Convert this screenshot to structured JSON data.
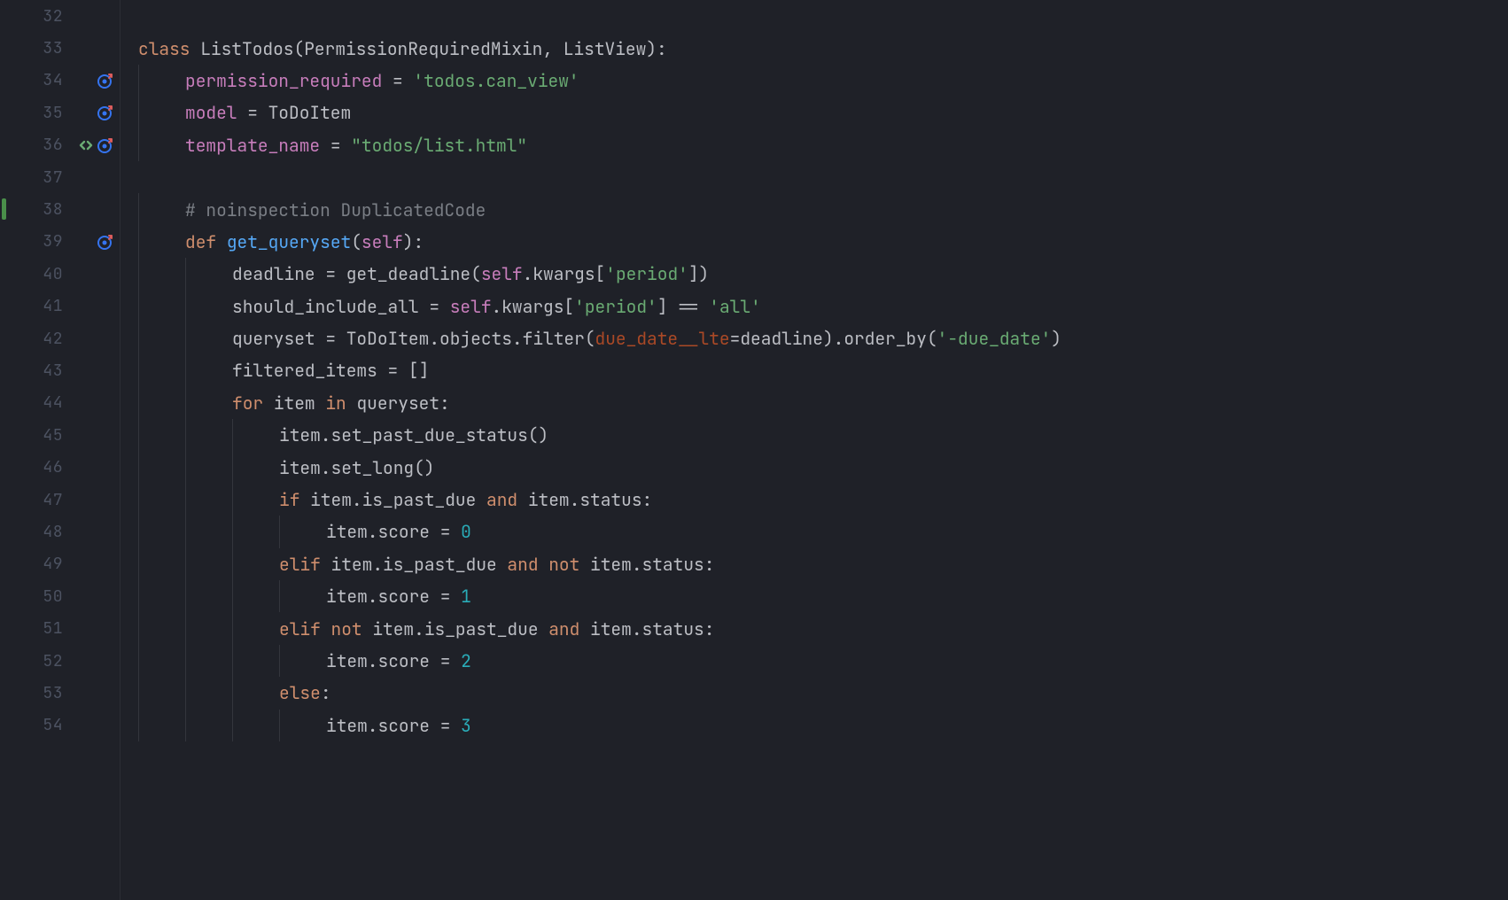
{
  "colors": {
    "background": "#1f2128",
    "keyword": "#cf8e6d",
    "string": "#6aab73",
    "number": "#2aacb8",
    "default": "#bcbec4",
    "function": "#56a8f5",
    "self": "#c77dbb",
    "comment": "#7a7e85",
    "kwarg_name": "#aa4926"
  },
  "gutter": {
    "lines": [
      {
        "n": "32",
        "icons": []
      },
      {
        "n": "33",
        "icons": []
      },
      {
        "n": "34",
        "icons": [
          "override"
        ]
      },
      {
        "n": "35",
        "icons": [
          "override"
        ]
      },
      {
        "n": "36",
        "icons": [
          "nav",
          "override"
        ]
      },
      {
        "n": "37",
        "icons": []
      },
      {
        "n": "38",
        "icons": [],
        "change": true
      },
      {
        "n": "39",
        "icons": [
          "override"
        ]
      },
      {
        "n": "40",
        "icons": []
      },
      {
        "n": "41",
        "icons": []
      },
      {
        "n": "42",
        "icons": []
      },
      {
        "n": "43",
        "icons": []
      },
      {
        "n": "44",
        "icons": []
      },
      {
        "n": "45",
        "icons": []
      },
      {
        "n": "46",
        "icons": []
      },
      {
        "n": "47",
        "icons": []
      },
      {
        "n": "48",
        "icons": []
      },
      {
        "n": "49",
        "icons": []
      },
      {
        "n": "50",
        "icons": []
      },
      {
        "n": "51",
        "icons": []
      },
      {
        "n": "52",
        "icons": []
      },
      {
        "n": "53",
        "icons": []
      },
      {
        "n": "54",
        "icons": []
      }
    ]
  },
  "source": {
    "lines": [
      [],
      [
        {
          "t": "class ",
          "c": "kw-orange"
        },
        {
          "t": "ListTodos",
          "c": "id"
        },
        {
          "t": "(",
          "c": "paren"
        },
        {
          "t": "PermissionRequiredMixin",
          "c": "id"
        },
        {
          "t": ", ",
          "c": "id"
        },
        {
          "t": "ListView",
          "c": "id"
        },
        {
          "t": ")",
          "c": "paren"
        },
        {
          "t": ":",
          "c": "id"
        }
      ],
      [
        {
          "t": "    ",
          "c": ""
        },
        {
          "t": "permission_required ",
          "c": "purple"
        },
        {
          "t": "= ",
          "c": "op"
        },
        {
          "t": "'todos.can_view'",
          "c": "str"
        }
      ],
      [
        {
          "t": "    ",
          "c": ""
        },
        {
          "t": "model ",
          "c": "purple"
        },
        {
          "t": "= ",
          "c": "op"
        },
        {
          "t": "ToDoItem",
          "c": "id"
        }
      ],
      [
        {
          "t": "    ",
          "c": ""
        },
        {
          "t": "template_name ",
          "c": "purple"
        },
        {
          "t": "= ",
          "c": "op"
        },
        {
          "t": "\"todos/list.html\"",
          "c": "str"
        }
      ],
      [],
      [
        {
          "t": "    ",
          "c": ""
        },
        {
          "t": "# noinspection DuplicatedCode",
          "c": "comment"
        }
      ],
      [
        {
          "t": "    ",
          "c": ""
        },
        {
          "t": "def ",
          "c": "kw-orange"
        },
        {
          "t": "get_queryset",
          "c": "fn-def"
        },
        {
          "t": "(",
          "c": "paren"
        },
        {
          "t": "self",
          "c": "purple"
        },
        {
          "t": ")",
          "c": "paren"
        },
        {
          "t": ":",
          "c": "id"
        }
      ],
      [
        {
          "t": "        ",
          "c": ""
        },
        {
          "t": "deadline ",
          "c": "id"
        },
        {
          "t": "= ",
          "c": "op"
        },
        {
          "t": "get_deadline",
          "c": "id"
        },
        {
          "t": "(",
          "c": "paren"
        },
        {
          "t": "self",
          "c": "purple"
        },
        {
          "t": ".kwargs[",
          "c": "id"
        },
        {
          "t": "'period'",
          "c": "str"
        },
        {
          "t": "])",
          "c": "id"
        }
      ],
      [
        {
          "t": "        ",
          "c": ""
        },
        {
          "t": "should_include_all ",
          "c": "id"
        },
        {
          "t": "= ",
          "c": "op"
        },
        {
          "t": "self",
          "c": "purple"
        },
        {
          "t": ".kwargs[",
          "c": "id"
        },
        {
          "t": "'period'",
          "c": "str"
        },
        {
          "t": "] == ",
          "c": "id"
        },
        {
          "t": "'all'",
          "c": "str"
        }
      ],
      [
        {
          "t": "        ",
          "c": ""
        },
        {
          "t": "queryset ",
          "c": "id"
        },
        {
          "t": "= ",
          "c": "op"
        },
        {
          "t": "ToDoItem.objects.filter(",
          "c": "id"
        },
        {
          "t": "due_date__lte",
          "c": "kwarg2"
        },
        {
          "t": "=deadline).order_by(",
          "c": "id"
        },
        {
          "t": "'-due_date'",
          "c": "str"
        },
        {
          "t": ")",
          "c": "id"
        }
      ],
      [
        {
          "t": "        ",
          "c": ""
        },
        {
          "t": "filtered_items ",
          "c": "id"
        },
        {
          "t": "= ",
          "c": "op"
        },
        {
          "t": "[]",
          "c": "id"
        }
      ],
      [
        {
          "t": "        ",
          "c": ""
        },
        {
          "t": "for ",
          "c": "kw-orange"
        },
        {
          "t": "item ",
          "c": "id"
        },
        {
          "t": "in ",
          "c": "kw-orange"
        },
        {
          "t": "queryset:",
          "c": "id"
        }
      ],
      [
        {
          "t": "            ",
          "c": ""
        },
        {
          "t": "item.set_past_due_status()",
          "c": "id"
        }
      ],
      [
        {
          "t": "            ",
          "c": ""
        },
        {
          "t": "item.set_long()",
          "c": "id"
        }
      ],
      [
        {
          "t": "            ",
          "c": ""
        },
        {
          "t": "if ",
          "c": "kw-orange"
        },
        {
          "t": "item.is_past_due ",
          "c": "id"
        },
        {
          "t": "and ",
          "c": "kw-orange"
        },
        {
          "t": "item.status:",
          "c": "id"
        }
      ],
      [
        {
          "t": "                ",
          "c": ""
        },
        {
          "t": "item.score ",
          "c": "id"
        },
        {
          "t": "= ",
          "c": "op"
        },
        {
          "t": "0",
          "c": "num"
        }
      ],
      [
        {
          "t": "            ",
          "c": ""
        },
        {
          "t": "elif ",
          "c": "kw-orange"
        },
        {
          "t": "item.is_past_due ",
          "c": "id"
        },
        {
          "t": "and not ",
          "c": "kw-orange"
        },
        {
          "t": "item.status:",
          "c": "id"
        }
      ],
      [
        {
          "t": "                ",
          "c": ""
        },
        {
          "t": "item.score ",
          "c": "id"
        },
        {
          "t": "= ",
          "c": "op"
        },
        {
          "t": "1",
          "c": "num"
        }
      ],
      [
        {
          "t": "            ",
          "c": ""
        },
        {
          "t": "elif not ",
          "c": "kw-orange"
        },
        {
          "t": "item.is_past_due ",
          "c": "id"
        },
        {
          "t": "and ",
          "c": "kw-orange"
        },
        {
          "t": "item.status:",
          "c": "id"
        }
      ],
      [
        {
          "t": "                ",
          "c": ""
        },
        {
          "t": "item.score ",
          "c": "id"
        },
        {
          "t": "= ",
          "c": "op"
        },
        {
          "t": "2",
          "c": "num"
        }
      ],
      [
        {
          "t": "            ",
          "c": ""
        },
        {
          "t": "else",
          "c": "kw-orange"
        },
        {
          "t": ":",
          "c": "id"
        }
      ],
      [
        {
          "t": "                ",
          "c": ""
        },
        {
          "t": "item.score ",
          "c": "id"
        },
        {
          "t": "= ",
          "c": "op"
        },
        {
          "t": "3",
          "c": "num"
        }
      ]
    ]
  }
}
